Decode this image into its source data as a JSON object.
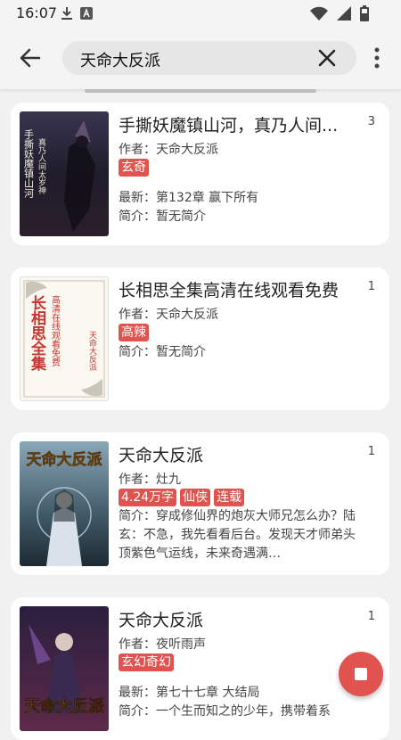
{
  "status_bar": {
    "time": "16:07",
    "icons_left": [
      "download-icon",
      "accessibility-a-icon"
    ],
    "icons_right": [
      "wifi-icon",
      "signal-icon",
      "battery-icon"
    ]
  },
  "search": {
    "query": "天命大反派",
    "back_icon": "back-arrow-icon",
    "clear_icon": "close-icon",
    "more_icon": "more-vert-icon"
  },
  "results": [
    {
      "title": "手撕妖魔镇山河，真乃人间...",
      "count": "3",
      "author": "作者：天命大反派",
      "tags": [
        "玄奇"
      ],
      "latest": "最新：第132章 赢下所有",
      "intro": "简介：暂无简介",
      "cover_text": "手撕妖魔镇山河 真乃人间太岁神"
    },
    {
      "title": "长相思全集高清在线观看免费",
      "count": "1",
      "author": "作者：天命大反派",
      "tags": [
        "高辣"
      ],
      "intro": "简介：暂无简介",
      "cover_text_main": "长相思全集",
      "cover_text_side": "高清在线观看免费",
      "cover_text_author": "天命大反派"
    },
    {
      "title": "天命大反派",
      "count": "1",
      "author": "作者：灶九",
      "tags": [
        "4.24万字",
        "仙侠",
        "连载"
      ],
      "intro": "简介：穿成修仙界的炮灰大师兄怎么办？陆玄：不急，我先看看后台。发现天才师弟头顶紫色气运线，未来奇遇满…",
      "cover_text": "天命大反派"
    },
    {
      "title": "天命大反派",
      "count": "1",
      "author": "作者：夜听雨声",
      "tags": [
        "玄幻奇幻"
      ],
      "latest": "最新：第七十七章 大结局",
      "intro": "简介：一个生而知之的少年，携带着系",
      "cover_text": "天命大反派"
    }
  ],
  "fab": {
    "icon": "stop-icon"
  },
  "colors": {
    "accent": "#e0534f",
    "background": "#f1f1f1",
    "card": "#ffffff"
  }
}
